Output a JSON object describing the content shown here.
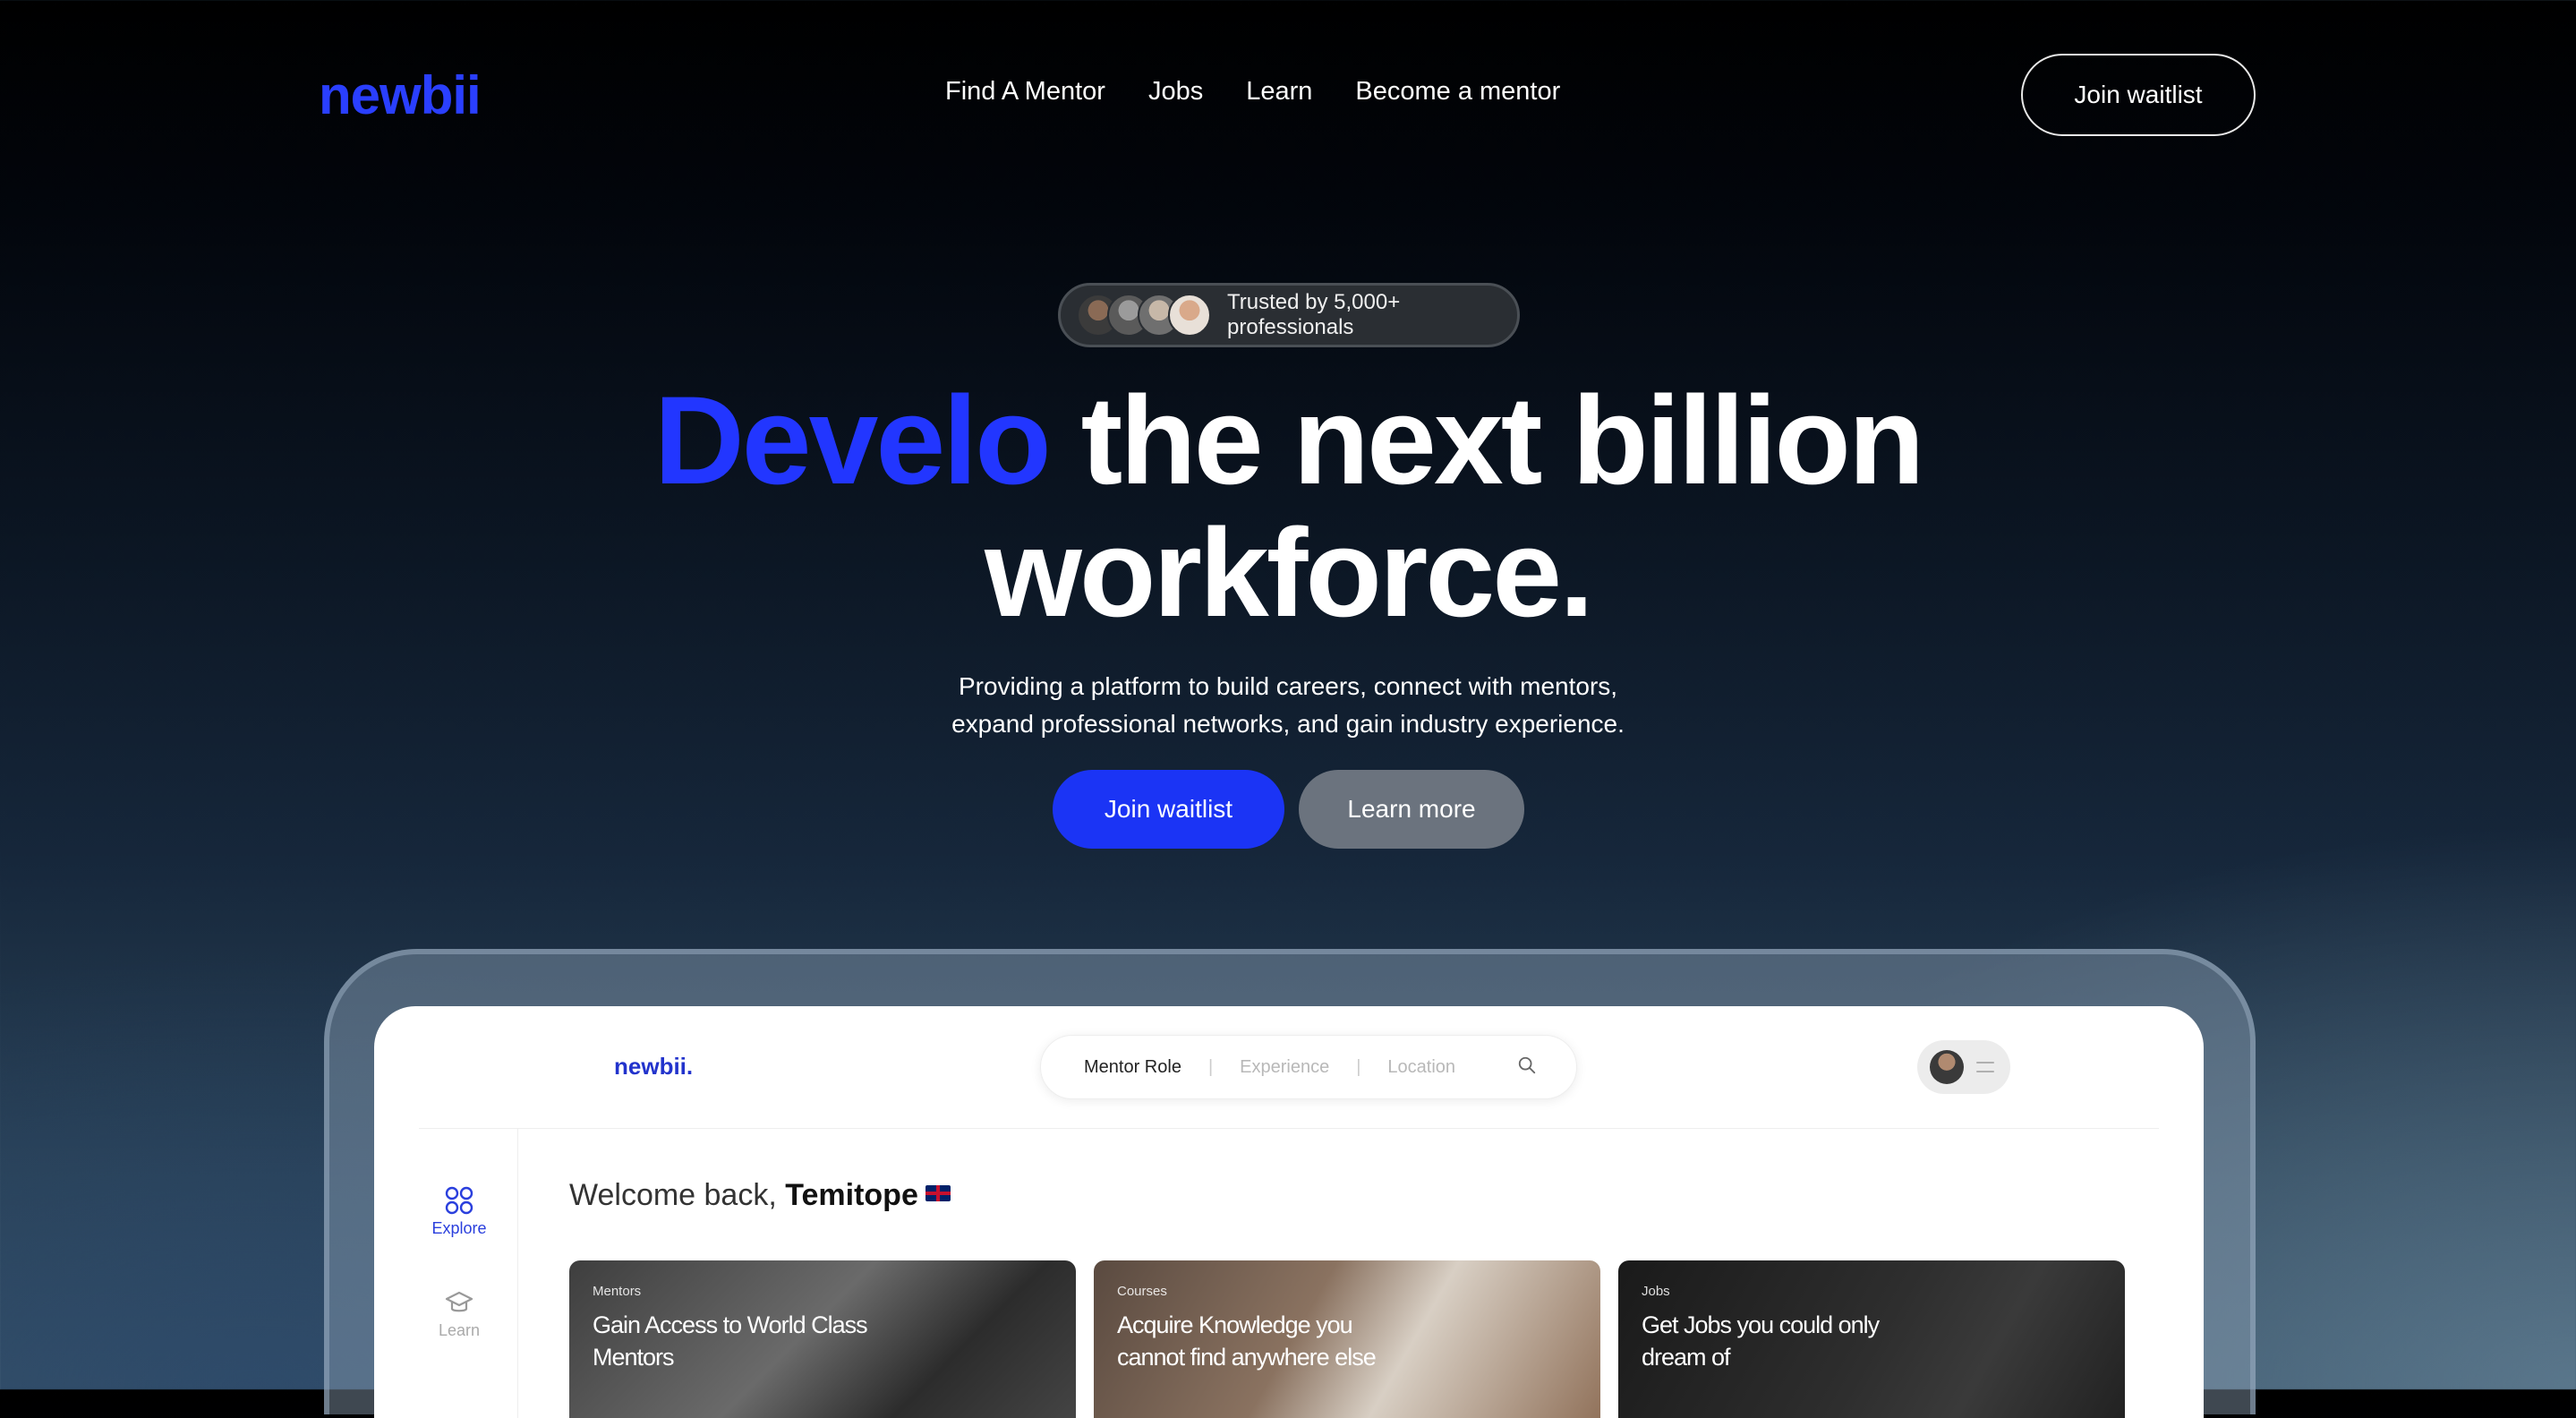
{
  "brand": {
    "logo": "newbii",
    "accent_color": "#2236ff"
  },
  "nav": {
    "links": [
      "Find A Mentor",
      "Jobs",
      "Learn",
      "Become a mentor"
    ],
    "cta_label": "Join waitlist"
  },
  "hero": {
    "trust_text": "Trusted by 5,000+ professionals",
    "headline_accent": "Develo",
    "headline_rest": "the next billion",
    "headline_line2": "workforce.",
    "subtitle_line1": "Providing a platform to build careers, connect with mentors,",
    "subtitle_line2": "expand professional networks, and gain industry experience.",
    "primary_button": "Join waitlist",
    "secondary_button": "Learn more"
  },
  "app_preview": {
    "logo": "newbii.",
    "search": {
      "segment_1": "Mentor Role",
      "segment_2": "Experience",
      "segment_3": "Location"
    },
    "sidebar": {
      "explore_label": "Explore",
      "learn_label": "Learn"
    },
    "welcome_prefix": "Welcome back,",
    "welcome_name": "Temitope",
    "cards": [
      {
        "tag": "Mentors",
        "title": "Gain Access to World Class Mentors"
      },
      {
        "tag": "Courses",
        "title": "Acquire Knowledge you cannot find anywhere else"
      },
      {
        "tag": "Jobs",
        "title": "Get Jobs you could only dream of"
      }
    ]
  }
}
